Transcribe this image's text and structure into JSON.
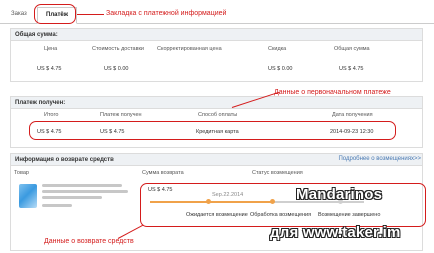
{
  "tabs": {
    "order": "Заказ",
    "payment": "Платёж"
  },
  "annotations": {
    "tab_note": "Закладка с платежной информацией",
    "payment_note": "Данные о первоначальном платеже",
    "refund_note": "Данные о возврате средств"
  },
  "total": {
    "title": "Общая сумма:",
    "headers": [
      "Цена",
      "Стоимость доставки",
      "Скорректированная цена",
      "Скидка",
      "Общая сумма"
    ],
    "values": [
      "US $ 4.75",
      "US $ 0.00",
      "",
      "US $ 0.00",
      "US $ 4.75"
    ]
  },
  "payment": {
    "title": "Платеж получен:",
    "headers": [
      "Итого",
      "Платеж получен",
      "Способ оплаты",
      "Дата получения"
    ],
    "values": [
      "US $ 4.75",
      "US $ 4.75",
      "Кредитная карта",
      "2014-09-23 12:30"
    ]
  },
  "refund": {
    "title": "Информация о возврате средств",
    "link": "Подробнее о возмещениях>>",
    "headers": [
      "Товар",
      "Сумма возврата",
      "Статус возмещения"
    ],
    "amount": "US $ 4.75",
    "date": "Sep.22.2014",
    "steps": [
      "Ожидается возмещение",
      "Обработка возмещения",
      "Возмещение завершено"
    ]
  },
  "watermark": {
    "line1": "Mandarinos",
    "line2": "для www.taker.im"
  },
  "colors": {
    "red": "#d41c1c",
    "header_bg": "#eef1f4",
    "progress": "#f0a24a",
    "link": "#4a7ab3"
  }
}
